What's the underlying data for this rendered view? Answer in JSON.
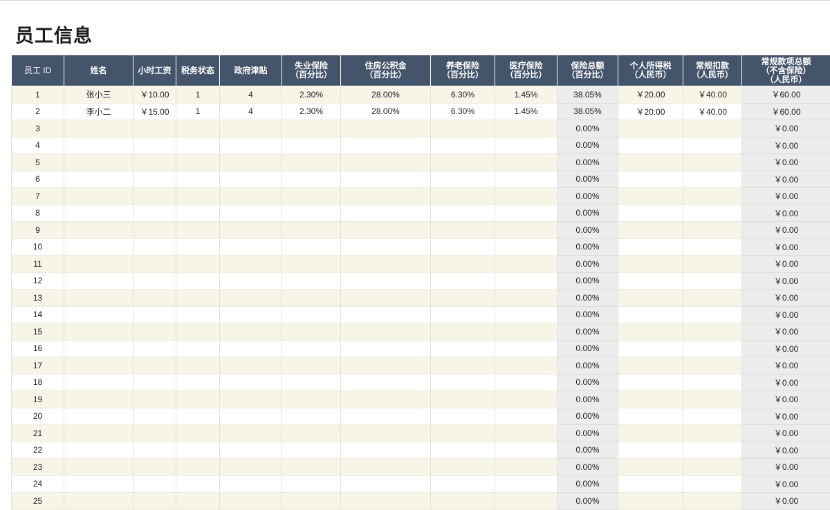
{
  "title": "员工信息",
  "headers": [
    "员工 ID",
    "姓名",
    "小时工资",
    "税务状态",
    "政府津贴",
    "失业保险\n（百分比）",
    "住房公积金\n（百分比）",
    "养老保险\n（百分比）",
    "医疗保险\n（百分比）",
    "保险总额\n（百分比）",
    "个人所得税\n（人民币）",
    "常规扣款\n（人民币）",
    "常规款项总额\n（不含保险）\n（人民币）"
  ],
  "rows": [
    [
      "1",
      "张小三",
      "￥10.00",
      "1",
      "4",
      "2.30%",
      "28.00%",
      "6.30%",
      "1.45%",
      "38.05%",
      "￥20.00",
      "￥40.00",
      "￥60.00"
    ],
    [
      "2",
      "李小二",
      "￥15.00",
      "1",
      "4",
      "2.30%",
      "28.00%",
      "6.30%",
      "1.45%",
      "38.05%",
      "￥20.00",
      "￥40.00",
      "￥60.00"
    ],
    [
      "3",
      "",
      "",
      "",
      "",
      "",
      "",
      "",
      "",
      "0.00%",
      "",
      "",
      "￥0.00"
    ],
    [
      "4",
      "",
      "",
      "",
      "",
      "",
      "",
      "",
      "",
      "0.00%",
      "",
      "",
      "￥0.00"
    ],
    [
      "5",
      "",
      "",
      "",
      "",
      "",
      "",
      "",
      "",
      "0.00%",
      "",
      "",
      "￥0.00"
    ],
    [
      "6",
      "",
      "",
      "",
      "",
      "",
      "",
      "",
      "",
      "0.00%",
      "",
      "",
      "￥0.00"
    ],
    [
      "7",
      "",
      "",
      "",
      "",
      "",
      "",
      "",
      "",
      "0.00%",
      "",
      "",
      "￥0.00"
    ],
    [
      "8",
      "",
      "",
      "",
      "",
      "",
      "",
      "",
      "",
      "0.00%",
      "",
      "",
      "￥0.00"
    ],
    [
      "9",
      "",
      "",
      "",
      "",
      "",
      "",
      "",
      "",
      "0.00%",
      "",
      "",
      "￥0.00"
    ],
    [
      "10",
      "",
      "",
      "",
      "",
      "",
      "",
      "",
      "",
      "0.00%",
      "",
      "",
      "￥0.00"
    ],
    [
      "11",
      "",
      "",
      "",
      "",
      "",
      "",
      "",
      "",
      "0.00%",
      "",
      "",
      "￥0.00"
    ],
    [
      "12",
      "",
      "",
      "",
      "",
      "",
      "",
      "",
      "",
      "0.00%",
      "",
      "",
      "￥0.00"
    ],
    [
      "13",
      "",
      "",
      "",
      "",
      "",
      "",
      "",
      "",
      "0.00%",
      "",
      "",
      "￥0.00"
    ],
    [
      "14",
      "",
      "",
      "",
      "",
      "",
      "",
      "",
      "",
      "0.00%",
      "",
      "",
      "￥0.00"
    ],
    [
      "15",
      "",
      "",
      "",
      "",
      "",
      "",
      "",
      "",
      "0.00%",
      "",
      "",
      "￥0.00"
    ],
    [
      "16",
      "",
      "",
      "",
      "",
      "",
      "",
      "",
      "",
      "0.00%",
      "",
      "",
      "￥0.00"
    ],
    [
      "17",
      "",
      "",
      "",
      "",
      "",
      "",
      "",
      "",
      "0.00%",
      "",
      "",
      "￥0.00"
    ],
    [
      "18",
      "",
      "",
      "",
      "",
      "",
      "",
      "",
      "",
      "0.00%",
      "",
      "",
      "￥0.00"
    ],
    [
      "19",
      "",
      "",
      "",
      "",
      "",
      "",
      "",
      "",
      "0.00%",
      "",
      "",
      "￥0.00"
    ],
    [
      "20",
      "",
      "",
      "",
      "",
      "",
      "",
      "",
      "",
      "0.00%",
      "",
      "",
      "￥0.00"
    ],
    [
      "21",
      "",
      "",
      "",
      "",
      "",
      "",
      "",
      "",
      "0.00%",
      "",
      "",
      "￥0.00"
    ],
    [
      "22",
      "",
      "",
      "",
      "",
      "",
      "",
      "",
      "",
      "0.00%",
      "",
      "",
      "￥0.00"
    ],
    [
      "23",
      "",
      "",
      "",
      "",
      "",
      "",
      "",
      "",
      "0.00%",
      "",
      "",
      "￥0.00"
    ],
    [
      "24",
      "",
      "",
      "",
      "",
      "",
      "",
      "",
      "",
      "0.00%",
      "",
      "",
      "￥0.00"
    ],
    [
      "25",
      "",
      "",
      "",
      "",
      "",
      "",
      "",
      "",
      "0.00%",
      "",
      "",
      "￥0.00"
    ]
  ]
}
